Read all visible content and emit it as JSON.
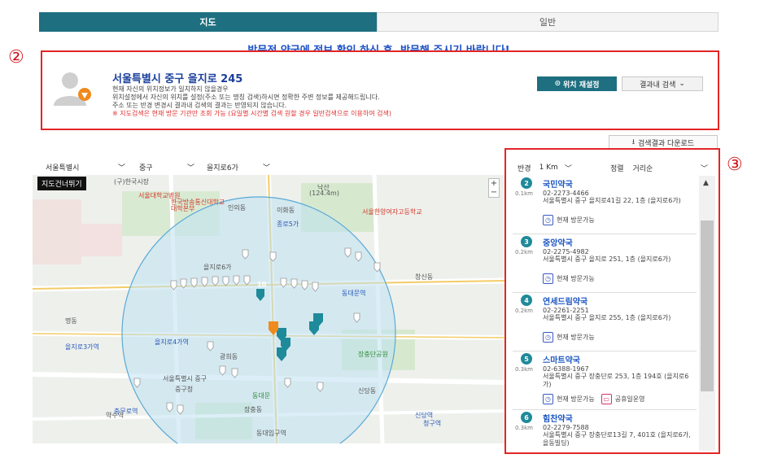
{
  "tabs": {
    "map": "지도",
    "general": "일반"
  },
  "notice": "방문전 약국에 정보 확인 하신 후, 방문해 주시기 바랍니다!",
  "markers": {
    "two": "②",
    "three": "③"
  },
  "location": {
    "title": "서울특별시 중구 을지로 245",
    "line1": "현재 자신의 위치정보가 일치하지 않을경우",
    "line2": "위치설정에서 자신의 위치를 설정(주소 또는 명칭 검색)하시면 정확한 주변 정보를 제공해드립니다.",
    "line3": "주소 또는 반경 변경시 결과내 검색의 결과는 반영되지 않습니다.",
    "line4": "※ 지도검색은 현재 방문 기관만 조회 가능 (요일별 시간별 검색 원할 경우 일반검색으로 이용하여 검색)",
    "reset_button": "위치 재설정",
    "search_in_results": "결과내 검색"
  },
  "download_button": "검색결과 다운로드",
  "filters": {
    "city": "서울특별시",
    "district": "중구",
    "dong": "을지로6가"
  },
  "map": {
    "skip_label": "지도건너뛰기",
    "labels": [
      "(구)한국시장",
      "서울대학교병원",
      "한국방송통신대학교",
      "대학본부",
      "인의동",
      "종로5가",
      "동대문역",
      "을지로4가역",
      "을지로3가역",
      "장충동",
      "동대입구역",
      "신당역",
      "약수역",
      "을지로6가",
      "이화동",
      "서울특별시 중구",
      "광희동",
      "신당동",
      "중구청",
      "동대문",
      "창신동",
      "충무로역",
      "명동",
      "장충단공원",
      "청구역",
      "(124.4m)",
      "낙산",
      "서울한양여자고등학교"
    ],
    "cluster_label": "10"
  },
  "results": {
    "radius_label": "반경",
    "radius_value": "1 Km",
    "sort_label": "정렬",
    "sort_value": "거리순",
    "status_label": "현재 방문가능",
    "holiday_label": "공휴일운영",
    "items": [
      {
        "num": "2",
        "dist": "0.1km",
        "name": "국민약국",
        "phone": "02-2273-4466",
        "addr": "서울특별시 중구 을지로41길 22, 1층 (을지로6가)",
        "holiday": ""
      },
      {
        "num": "3",
        "dist": "0.2km",
        "name": "중앙약국",
        "phone": "02-2275-4982",
        "addr": "서울특별시 중구 을지로 251, 1층 (을지로6가)",
        "holiday": ""
      },
      {
        "num": "4",
        "dist": "0.2km",
        "name": "연세드림약국",
        "phone": "02-2261-2251",
        "addr": "서울특별시 중구 을지로 255, 1층 (을지로6가)",
        "holiday": ""
      },
      {
        "num": "5",
        "dist": "0.3km",
        "name": "스마트약국",
        "phone": "02-6388-1967",
        "addr": "서울특별시 중구 장충단로 253, 1층 194호 (을지로6가)",
        "holiday": "공휴일운영"
      },
      {
        "num": "6",
        "dist": "0.3km",
        "name": "힘찬약국",
        "phone": "02-2279-7588",
        "addr": "서울특별시 중구 장충단로13길 7, 401호 (을지로6가, 을동빌딩)",
        "holiday": ""
      }
    ]
  },
  "colors": {
    "primary": "#1e6f80",
    "highlight": "#e32526",
    "link": "#1c56c2"
  }
}
